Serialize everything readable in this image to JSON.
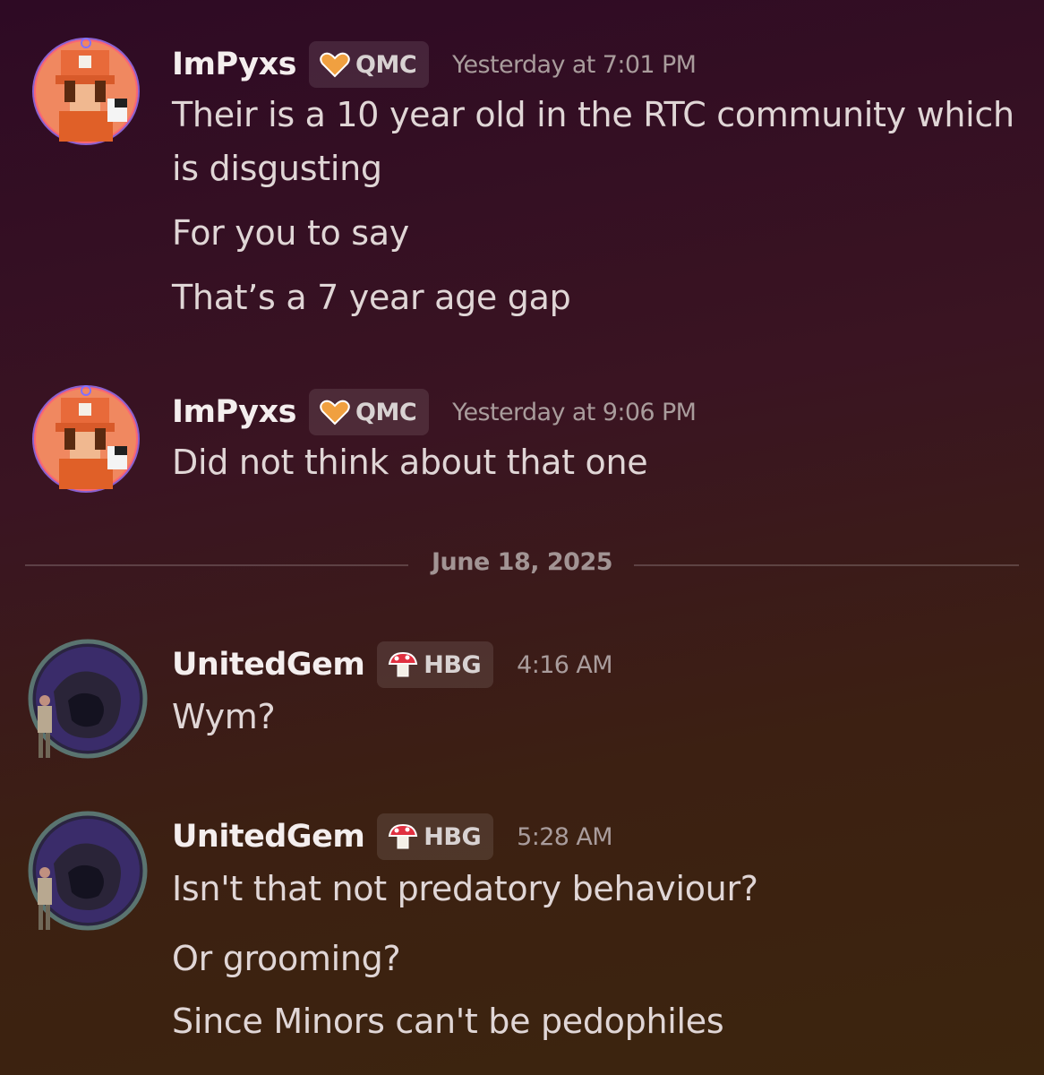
{
  "messages": [
    {
      "username": "ImPyxs",
      "tag": "QMC",
      "tag_icon": "heart-icon",
      "tag_color": "#f0a040",
      "timestamp": "Yesterday at 7:01 PM",
      "lines": [
        "Their is a 10 year old in the RTC community which",
        "is disgusting",
        "For you to say",
        "That’s a 7 year age gap"
      ]
    },
    {
      "username": "ImPyxs",
      "tag": "QMC",
      "tag_icon": "heart-icon",
      "tag_color": "#f0a040",
      "timestamp": "Yesterday at 9:06 PM",
      "lines": [
        "Did not think about that one"
      ]
    },
    {
      "username": "UnitedGem",
      "tag": "HBG",
      "tag_icon": "mushroom-icon",
      "tag_color": "#e03040",
      "timestamp": "4:16 AM",
      "lines": [
        "Wym?"
      ]
    },
    {
      "username": "UnitedGem",
      "tag": "HBG",
      "tag_icon": "mushroom-icon",
      "tag_color": "#e03040",
      "timestamp": "5:28 AM",
      "lines": [
        "Isn't that not predatory behaviour?",
        "Or grooming?",
        "Since Minors can't be pedophiles"
      ]
    }
  ],
  "date_divider": "June 18, 2025"
}
